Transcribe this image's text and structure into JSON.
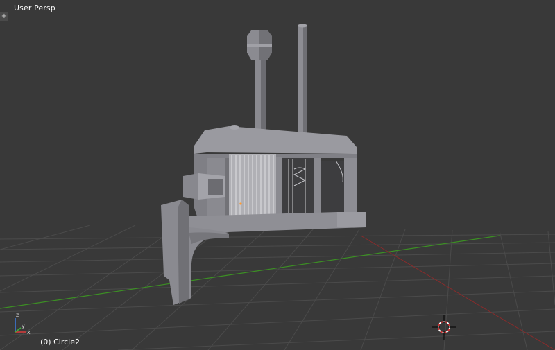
{
  "viewport": {
    "view_name": "User Persp",
    "object_info": "(0) Circle2",
    "toolshelf_toggle": "+"
  },
  "colors": {
    "background": "#393939",
    "grid_line": "#4a4a4a",
    "x_axis": "#8b2b2b",
    "y_axis": "#3c8f24",
    "model": "#8f8f96",
    "text": "#ffffff"
  },
  "icons": {
    "axis_gizmo": "xyz-axis-icon",
    "cursor": "3d-cursor-icon",
    "toolshelf": "plus-icon"
  }
}
